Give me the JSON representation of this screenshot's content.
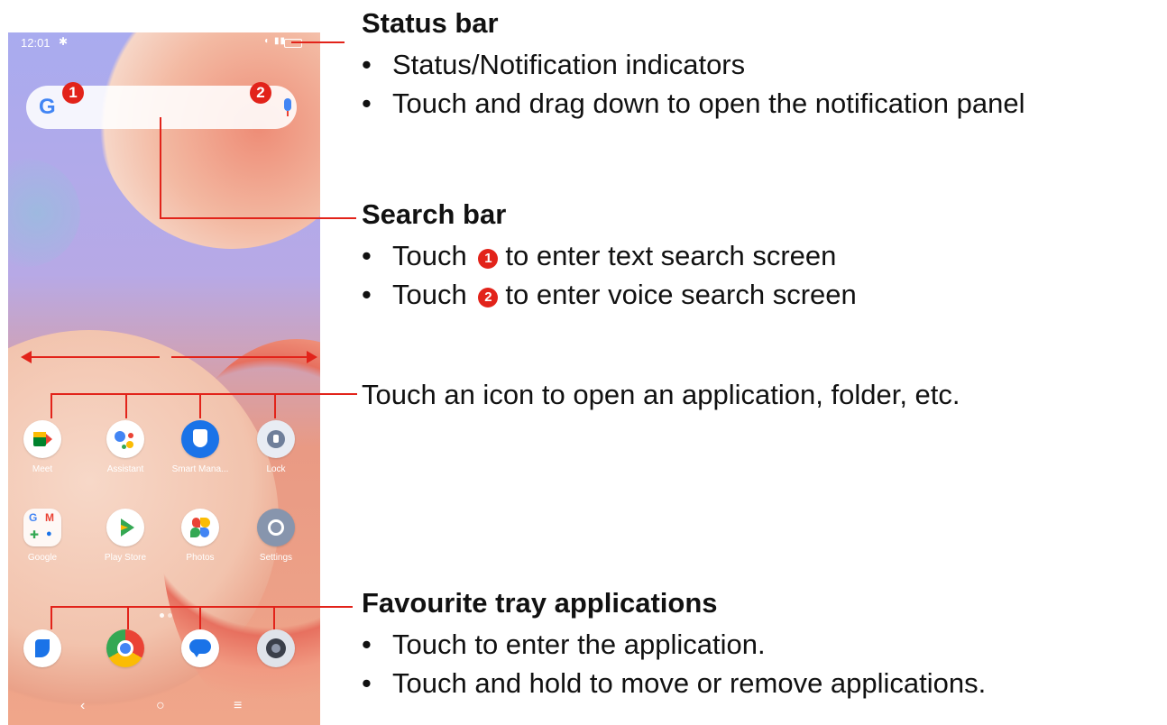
{
  "status_bar": {
    "time": "12:01"
  },
  "search_bar": {
    "logo": "G",
    "badge1": "1",
    "badge2": "2"
  },
  "apps_row1": [
    {
      "label": "Meet",
      "icon": "meet-icon"
    },
    {
      "label": "Assistant",
      "icon": "assistant-icon"
    },
    {
      "label": "Smart Mana...",
      "icon": "shield-icon"
    },
    {
      "label": "Lock",
      "icon": "lock-icon"
    }
  ],
  "apps_row2": [
    {
      "label": "Google",
      "icon": "google-folder-icon"
    },
    {
      "label": "Play Store",
      "icon": "play-store-icon"
    },
    {
      "label": "Photos",
      "icon": "photos-icon"
    },
    {
      "label": "Settings",
      "icon": "settings-gear-icon"
    }
  ],
  "tray": [
    {
      "icon": "phone-icon"
    },
    {
      "icon": "chrome-icon"
    },
    {
      "icon": "messages-icon"
    },
    {
      "icon": "camera-icon"
    }
  ],
  "annotations": {
    "status_bar": {
      "title": "Status bar",
      "items": [
        "Status/Notification indicators",
        "Touch and drag down to open the notification panel"
      ]
    },
    "search_bar": {
      "title": "Search bar",
      "item1_pre": "Touch",
      "item1_num": "1",
      "item1_post": "to enter text search screen",
      "item2_pre": "Touch",
      "item2_num": "2",
      "item2_post": "to enter voice search screen"
    },
    "icons": "Touch an icon to open an application, folder, etc.",
    "tray": {
      "title": "Favourite tray applications",
      "items": [
        "Touch to enter the application.",
        "Touch and hold to move or remove applications."
      ]
    },
    "bullet": "•"
  },
  "colors": {
    "accent_red": "#e2231a"
  }
}
